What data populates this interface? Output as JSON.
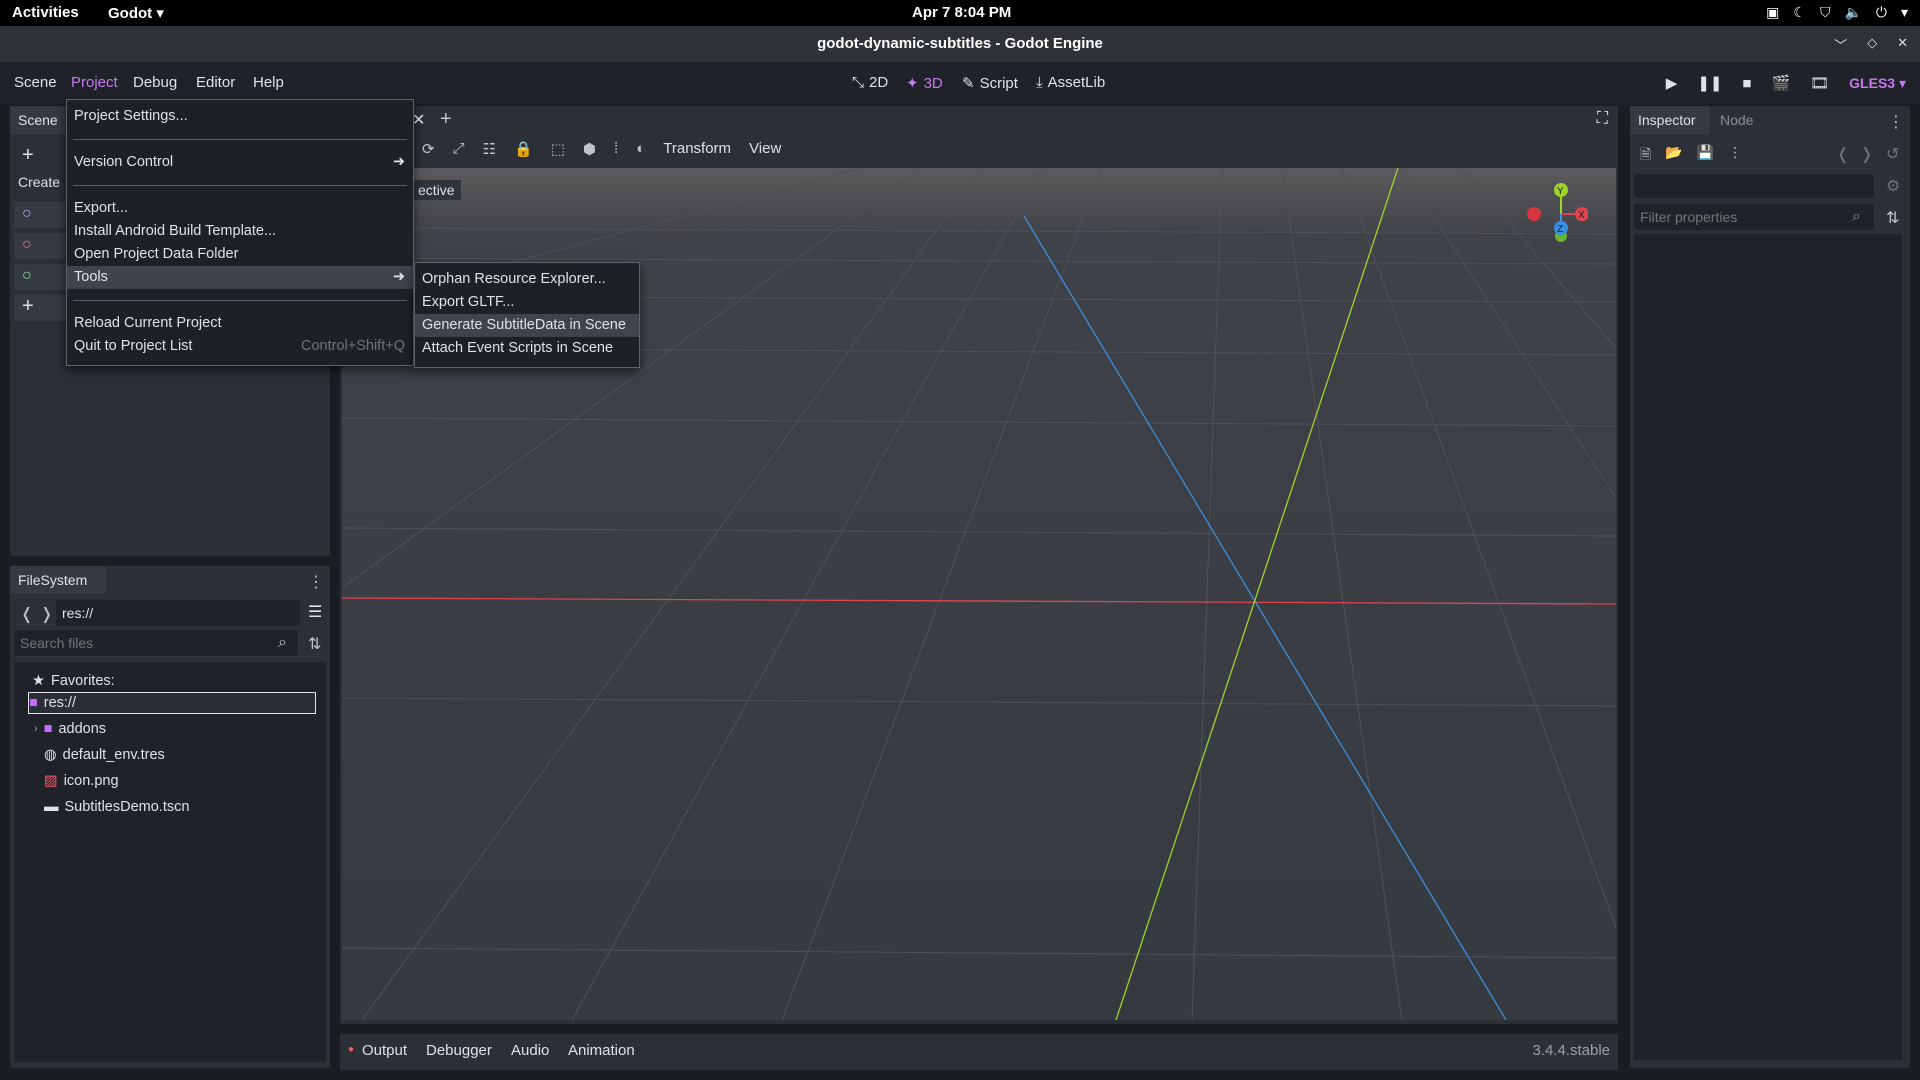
{
  "system_bar": {
    "activities": "Activities",
    "app_menu": "Godot ▾",
    "clock": "Apr 7   8:04 PM"
  },
  "window": {
    "title": "godot-dynamic-subtitles - Godot Engine"
  },
  "main_menu": {
    "scene": "Scene",
    "project": "Project",
    "debug": "Debug",
    "editor": "Editor",
    "help": "Help"
  },
  "workspaces": {
    "two_d": "2D",
    "three_d": "3D",
    "script": "Script",
    "assetlib": "AssetLib"
  },
  "renderer": "GLES3 ▾",
  "scene_dock": {
    "tab": "Scene",
    "create_label": "Create"
  },
  "project_menu": {
    "items": [
      "Project Settings...",
      "Version Control",
      "Export...",
      "Install Android Build Template...",
      "Open Project Data Folder",
      "Tools",
      "Reload Current Project",
      "Quit to Project List"
    ],
    "quit_shortcut": "Control+Shift+Q"
  },
  "tools_submenu": {
    "items": [
      "Orphan Resource Explorer...",
      "Export GLTF...",
      "Generate SubtitleData in Scene",
      "Attach Event Scripts in Scene"
    ]
  },
  "viewport_toolbar": {
    "transform": "Transform",
    "view": "View",
    "perspective_label": "ective"
  },
  "gizmo": {
    "y": "Y",
    "x": "X",
    "z": "Z"
  },
  "filesystem": {
    "tab": "FileSystem",
    "path": "res://",
    "search_placeholder": "Search files",
    "favorites": "Favorites:",
    "root": "res://",
    "entries": [
      "addons",
      "default_env.tres",
      "icon.png",
      "SubtitlesDemo.tscn"
    ]
  },
  "bottom_panel": {
    "output": "Output",
    "debugger": "Debugger",
    "audio": "Audio",
    "animation": "Animation",
    "version": "3.4.4.stable"
  },
  "inspector": {
    "tab_inspector": "Inspector",
    "tab_node": "Node",
    "filter_placeholder": "Filter properties"
  },
  "colors": {
    "accent": "#c778f0",
    "axis_x": "#e0444f",
    "axis_y": "#9ed42a",
    "axis_z": "#3a8fe0"
  }
}
